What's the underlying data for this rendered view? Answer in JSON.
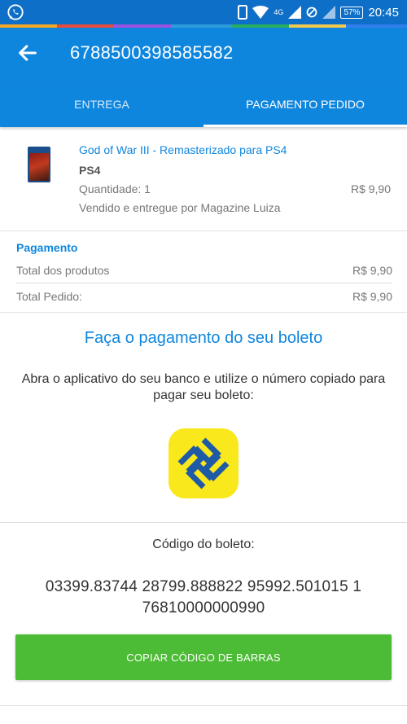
{
  "status_bar": {
    "network": "4G",
    "battery": "57%",
    "time": "20:45"
  },
  "app_bar": {
    "title": "6788500398585582"
  },
  "tabs": [
    {
      "label": "ENTREGA",
      "selected": false
    },
    {
      "label": "PAGAMENTO PEDIDO",
      "selected": true
    }
  ],
  "product": {
    "name": "God of War III - Remasterizado para PS4",
    "platform": "PS4",
    "quantity": "Quantidade: 1",
    "price": "R$ 9,90",
    "seller": "Vendido e entregue por Magazine Luiza"
  },
  "payment": {
    "title": "Pagamento",
    "rows": [
      {
        "label": "Total dos produtos",
        "value": "R$ 9,90"
      },
      {
        "label": "Total Pedido:",
        "value": "R$ 9,90"
      }
    ]
  },
  "instructions": {
    "title": "Faça o pagamento do seu boleto",
    "description": "Abra o aplicativo do seu banco e utilize o número copiado para pagar seu boleto:"
  },
  "boleto": {
    "label": "Código do boleto:",
    "code": "03399.83744 28799.888822 95992.501015 1 76810000000990",
    "button": "COPIAR CÓDIGO DE BARRAS"
  },
  "colors": {
    "primary": "#0f86de",
    "status_bar": "#0d6fc7",
    "button": "#4cbb35",
    "bank_logo": "#f8e81c"
  }
}
